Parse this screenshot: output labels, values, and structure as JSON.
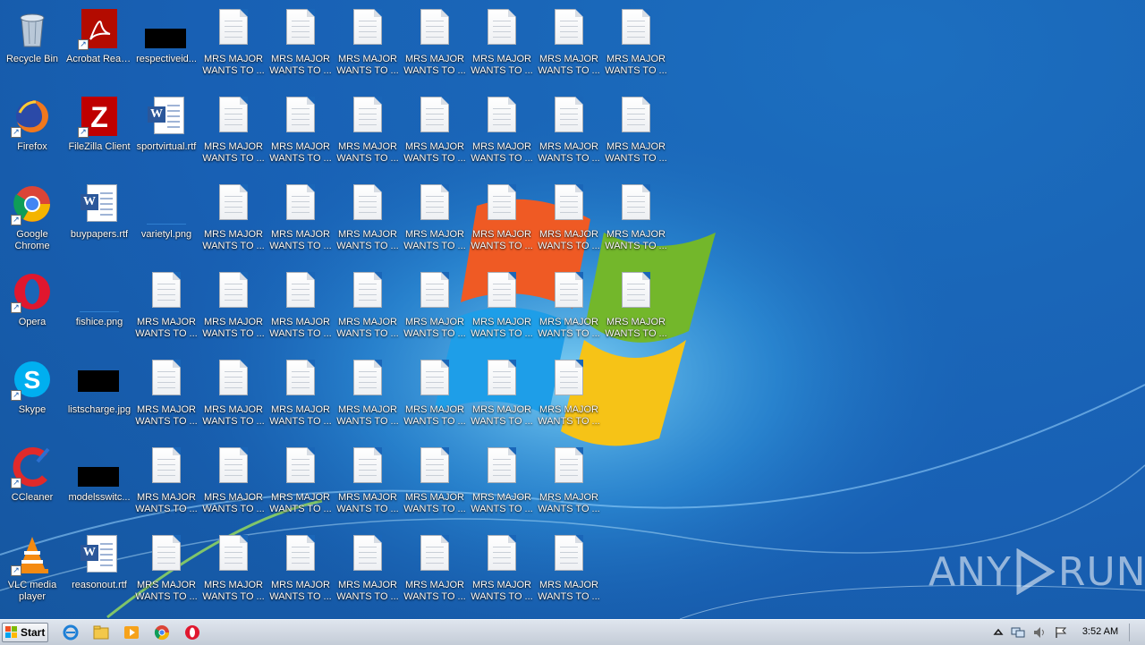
{
  "desktop": {
    "left_column": [
      {
        "label": "Recycle Bin",
        "icon": "recycle-bin-icon"
      },
      {
        "label": "Firefox",
        "icon": "firefox-icon"
      },
      {
        "label": "Google Chrome",
        "icon": "chrome-icon"
      },
      {
        "label": "Opera",
        "icon": "opera-icon"
      },
      {
        "label": "Skype",
        "icon": "skype-icon"
      },
      {
        "label": "CCleaner",
        "icon": "ccleaner-icon"
      },
      {
        "label": "VLC media player",
        "icon": "vlc-icon"
      }
    ],
    "second_column": [
      {
        "label": "Acrobat Reader DC",
        "icon": "acrobat-icon"
      },
      {
        "label": "FileZilla Client",
        "icon": "filezilla-icon"
      },
      {
        "label": "buypapers.rtf",
        "icon": "word-doc-icon"
      },
      {
        "label": "fishice.png",
        "icon": "image-thumbnail-icon"
      },
      {
        "label": "listscharge.jpg",
        "icon": "image-thumbnail-icon"
      },
      {
        "label": "modelsswitc...",
        "icon": "image-thumbnail-icon"
      },
      {
        "label": "reasonout.rtf",
        "icon": "word-doc-icon"
      }
    ],
    "third_column": [
      {
        "label": "respectiveid...",
        "icon": "image-thumbnail-icon"
      },
      {
        "label": "sportvirtual.rtf",
        "icon": "word-doc-icon"
      },
      {
        "label": "varietyl.png",
        "icon": "image-thumbnail-icon"
      }
    ],
    "ransom_note_label": "MRS MAJOR WANTS TO ..."
  },
  "taskbar": {
    "start_label": "Start",
    "quick_launch": [
      "internet-explorer-icon",
      "explorer-folder-icon",
      "media-player-icon",
      "chrome-icon",
      "opera-icon"
    ],
    "tray": [
      "show-hidden-icons-icon",
      "network-icon",
      "volume-icon",
      "action-center-flag-icon"
    ],
    "clock": "3:52 AM"
  },
  "watermark": "ANY RUN",
  "colors": {
    "wallpaper": "#1a66b8",
    "taskbar": "#d3dae3",
    "label_text": "#ffffff"
  }
}
